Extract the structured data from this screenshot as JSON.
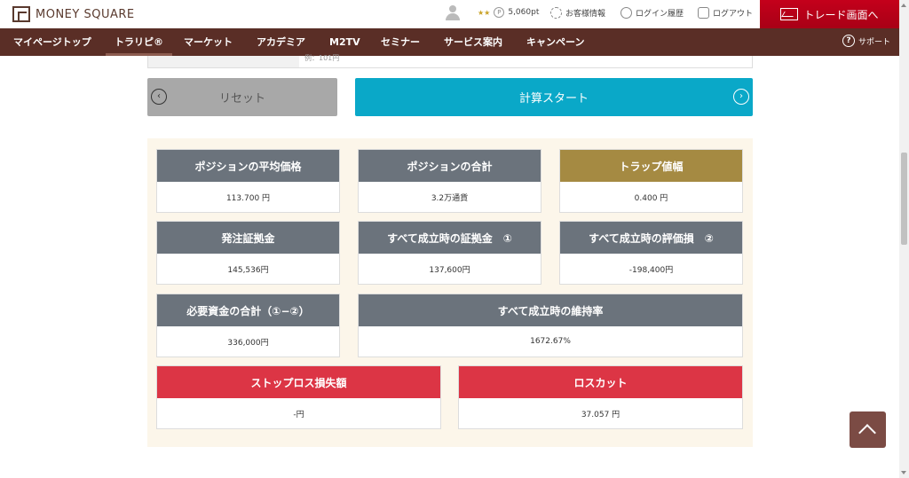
{
  "header": {
    "brand": "MONEY SQUARE",
    "stars": "★★",
    "points": "5,060pt",
    "customer_info": "お客様情報",
    "login_history": "ログイン履歴",
    "logout": "ログアウト",
    "trade_screen": "トレード画面へ"
  },
  "nav": {
    "items": [
      "マイページトップ",
      "トラリピ®",
      "マーケット",
      "アカデミア",
      "M2TV",
      "セミナー",
      "サービス案内",
      "キャンペーン"
    ],
    "active_index": 1,
    "support": "サポート"
  },
  "form": {
    "hint": "例：101円"
  },
  "actions": {
    "reset": "リセット",
    "start": "計算スタート"
  },
  "results": {
    "avg_price": {
      "label": "ポジションの平均価格",
      "value": "113.700 円"
    },
    "position_total": {
      "label": "ポジションの合計",
      "value": "3.2万通貨"
    },
    "trap_width": {
      "label": "トラップ値幅",
      "value": "0.400 円"
    },
    "order_margin": {
      "label": "発注証拠金",
      "value": "145,536円"
    },
    "margin_all_filled": {
      "label": "すべて成立時の証拠金　①",
      "value": "137,600円"
    },
    "unrealized_loss": {
      "label": "すべて成立時の評価損　②",
      "value": "-198,400円"
    },
    "required_funds": {
      "label": "必要資金の合計（①−②）",
      "value": "336,000円"
    },
    "maintenance_rate": {
      "label": "すべて成立時の維持率",
      "value": "1672.67%"
    },
    "stop_loss": {
      "label": "ストップロス損失額",
      "value": "-円"
    },
    "loss_cut": {
      "label": "ロスカット",
      "value": "37.057 円"
    }
  },
  "colors": {
    "nav_bg": "#5a2e26",
    "accent_cyan": "#0aa8c8",
    "header_gray": "#6b737c",
    "header_gold": "#a58a42",
    "header_red": "#dc3545",
    "trade_red": "#c4001b"
  }
}
